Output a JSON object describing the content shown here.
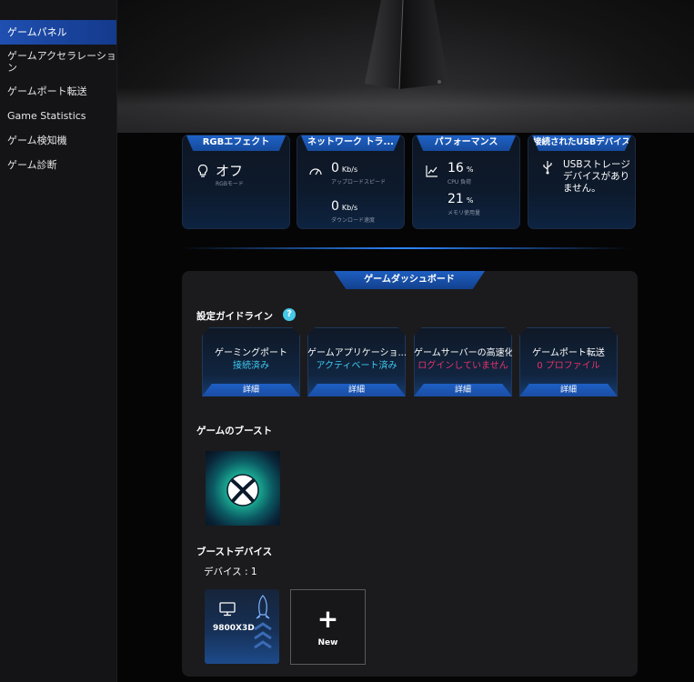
{
  "sidebar": {
    "items": [
      {
        "label": "ゲームパネル",
        "active": true
      },
      {
        "label": "ゲームアクセラレーション"
      },
      {
        "label": "ゲームポート転送"
      },
      {
        "label": "Game Statistics"
      },
      {
        "label": "ゲーム検知機"
      },
      {
        "label": "ゲーム診断"
      }
    ]
  },
  "hero": {
    "image": "gaming-router-tower"
  },
  "status_cards": {
    "rgb": {
      "title": "RGBエフェクト",
      "value": "オフ",
      "sub": "RGBモード",
      "icon": "lightbulb-icon"
    },
    "network": {
      "title": "ネットワーク トラ...",
      "up_value": "0",
      "up_unit": "Kb/s",
      "up_label": "アップロードスピード",
      "down_value": "0",
      "down_unit": "Kb/s",
      "down_label": "ダウンロード速度",
      "icon": "speedometer-icon"
    },
    "performance": {
      "title": "パフォーマンス",
      "cpu_value": "16",
      "cpu_unit": "%",
      "cpu_label": "CPU 負荷",
      "mem_value": "21",
      "mem_unit": "%",
      "mem_label": "メモリ使用量",
      "icon": "chart-line-icon"
    },
    "usb": {
      "title": "接続されたUSBデバイス",
      "text": "USBストレージ デバイスがありません。",
      "icon": "usb-icon"
    }
  },
  "dashboard": {
    "tab": "ゲームダッシュボード",
    "guide_title": "設定ガイドライン",
    "guide_cards": [
      {
        "title": "ゲーミングポート",
        "status": "接続済み",
        "status_color": "#3fc9f2",
        "detail": "詳細"
      },
      {
        "title": "ゲームアプリケーショ...",
        "status": "アクティベート済み",
        "status_color": "#3fc9f2",
        "detail": "詳細"
      },
      {
        "title": "ゲームサーバーの高速化",
        "status": "ログインしていません",
        "status_color": "#e8336b",
        "detail": "詳細"
      },
      {
        "title": "ゲームポート転送",
        "status": "0 プロファイル",
        "status_color": "#e8336b",
        "detail": "詳細"
      }
    ],
    "boost_title": "ゲームのブースト",
    "boost_game_icon": "xbox-icon",
    "device_title": "ブーストデバイス",
    "device_count": "デバイス : 1",
    "device": {
      "name": "9800X3D",
      "icons": [
        "monitor-icon",
        "rocket-icon"
      ]
    },
    "new_label": "New"
  },
  "colors": {
    "accent_blue": "#1f63c8",
    "status_ok": "#3fc9f2",
    "status_warn": "#e8336b"
  }
}
